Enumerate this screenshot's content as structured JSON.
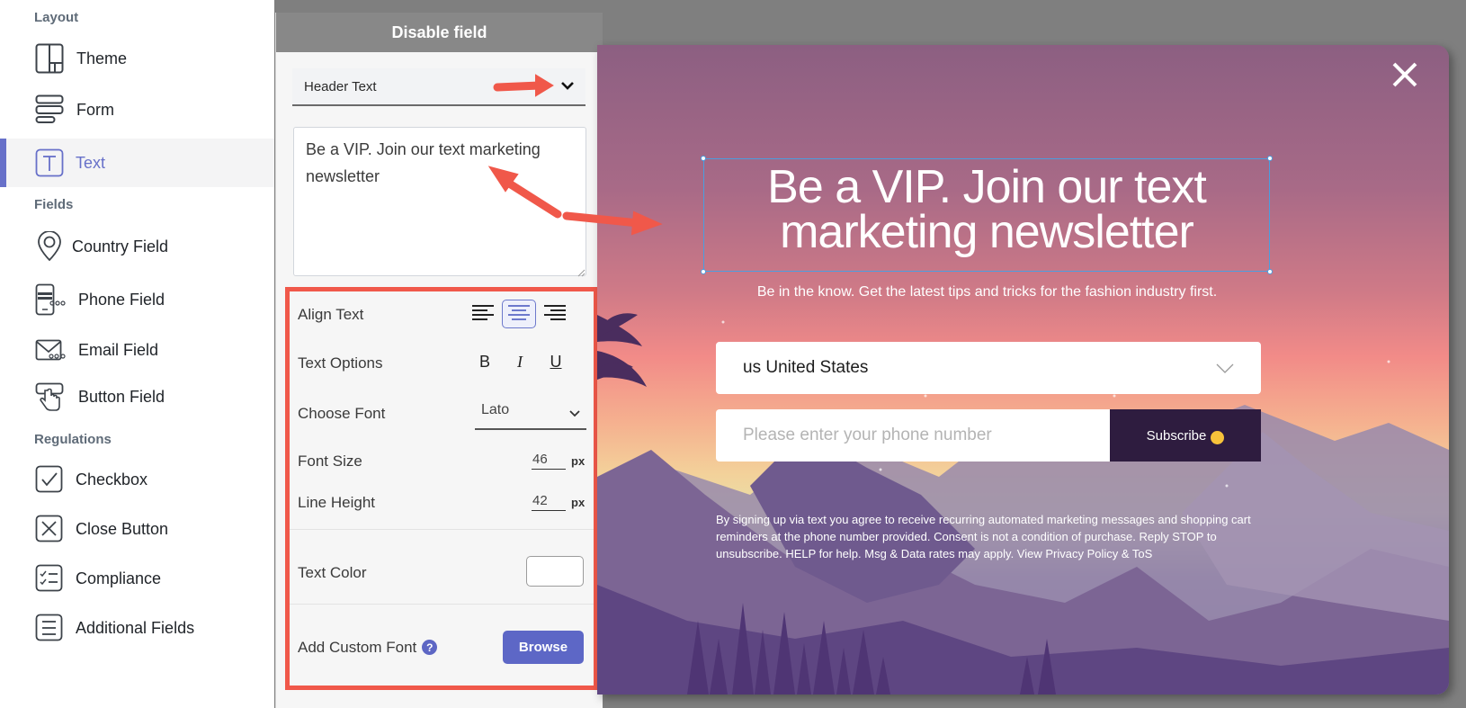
{
  "sidebar": {
    "sections": [
      {
        "title": "Layout"
      },
      {
        "title": "Fields"
      },
      {
        "title": "Regulations"
      }
    ],
    "items": [
      {
        "label": "Theme",
        "icon": "theme-layout-icon"
      },
      {
        "label": "Form",
        "icon": "form-rows-icon"
      },
      {
        "label": "Text",
        "icon": "text-t-icon",
        "active": true
      },
      {
        "label": "Country Field",
        "icon": "location-pin-icon"
      },
      {
        "label": "Phone Field",
        "icon": "phone-field-icon"
      },
      {
        "label": "Email Field",
        "icon": "email-field-icon"
      },
      {
        "label": "Button Field",
        "icon": "button-pointer-icon"
      },
      {
        "label": "Checkbox",
        "icon": "checkbox-icon"
      },
      {
        "label": "Close Button",
        "icon": "close-box-icon"
      },
      {
        "label": "Compliance",
        "icon": "checklist-icon"
      },
      {
        "label": "Additional Fields",
        "icon": "list-lines-icon"
      }
    ],
    "accent_color": "#6770c9"
  },
  "panel": {
    "header": "Disable field",
    "text_element_select": "Header Text",
    "text_content": "Be a VIP. Join our text marketing newsletter",
    "align_label": "Align Text",
    "align_options": [
      "left",
      "center",
      "right"
    ],
    "align_selected": "center",
    "text_options_label": "Text Options",
    "text_options": {
      "bold": "B",
      "italic": "I",
      "underline": "U"
    },
    "font_label": "Choose Font",
    "font_value": "Lato",
    "font_size_label": "Font Size",
    "font_size_value": "46",
    "line_height_label": "Line Height",
    "line_height_value": "42",
    "unit": "px",
    "text_color_label": "Text Color",
    "text_color_value": "#ffffff",
    "custom_font_label": "Add Custom Font",
    "help_glyph": "?",
    "browse_label": "Browse",
    "highlight_color": "#f0584a",
    "button_color": "#5d67c6"
  },
  "popup": {
    "headline": "Be a VIP. Join our text marketing newsletter",
    "headline_line1": "Be a VIP. Join our text",
    "headline_line2": "marketing newsletter",
    "subheadline": "Be in the know. Get the latest tips and tricks for the fashion industry first.",
    "country_value": "us United States",
    "phone_placeholder": "Please enter your phone number",
    "subscribe_label": "Subscribe",
    "disclaimer": "By signing up via text you agree to receive recurring automated marketing messages and shopping cart reminders at the phone number provided. Consent is not a condition of purchase. Reply STOP to unsubscribe. HELP for help. Msg & Data rates may apply. View Privacy Policy & ToS",
    "button_color": "#2e1c3f"
  }
}
